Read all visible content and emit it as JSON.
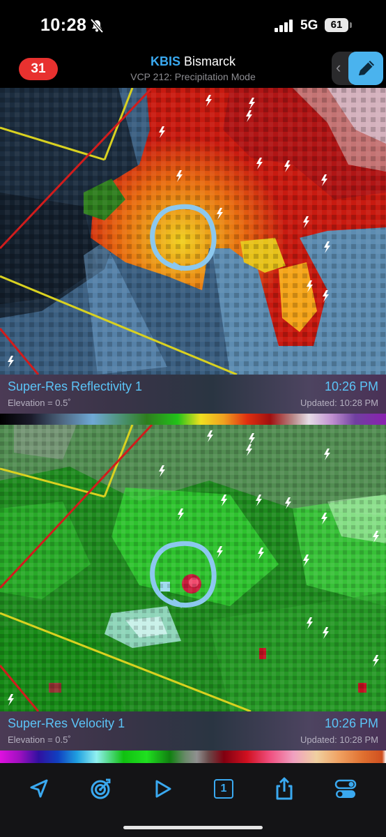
{
  "status_bar": {
    "time": "10:28",
    "bell_icon": "bell-slash-icon",
    "network": "5G",
    "battery": "61"
  },
  "header": {
    "badge_count": "31",
    "station_code": "KBIS",
    "station_city": "Bismarck",
    "vcp_mode": "VCP 212: Precipitation Mode"
  },
  "panels": [
    {
      "product": "Super-Res Reflectivity 1",
      "time": "10:26 PM",
      "elevation": "Elevation = 0.5˚",
      "updated": "Updated: 10:28 PM"
    },
    {
      "product": "Super-Res Velocity 1",
      "time": "10:26 PM",
      "elevation": "Elevation = 0.5˚",
      "updated": "Updated: 10:28 PM"
    }
  ],
  "toolbar": {
    "icons": [
      "location-arrow-icon",
      "radar-target-icon",
      "play-icon",
      "panel-count-icon",
      "share-icon",
      "settings-toggle-icon"
    ],
    "panel_count": "1"
  },
  "colors": {
    "accent": "#4ab3ee",
    "badge": "#e8312f",
    "product_text": "#5bc4f7"
  }
}
